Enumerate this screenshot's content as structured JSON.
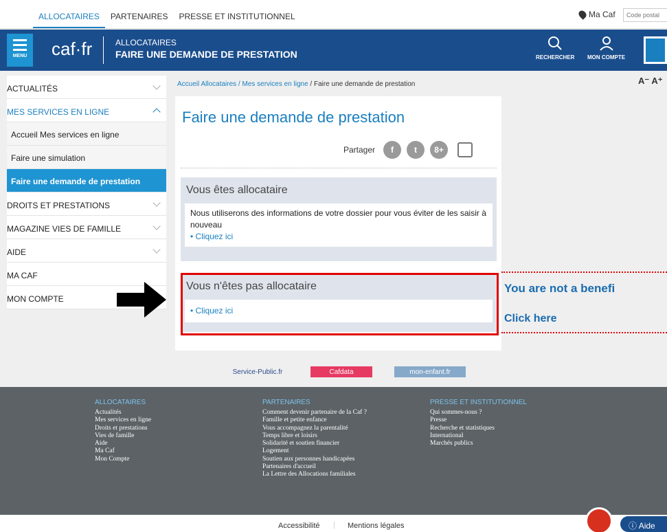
{
  "topbar": {
    "links": [
      "ALLOCATAIRES",
      "PARTENAIRES",
      "PRESSE ET INSTITUTIONNEL"
    ],
    "ma_caf": "Ma Caf",
    "postal_placeholder": "Code postal"
  },
  "header": {
    "menu_label": "MENU",
    "logo": "caf·fr",
    "section": "ALLOCATAIRES",
    "title": "FAIRE UNE DEMANDE DE PRESTATION",
    "search_label": "RECHERCHER",
    "account_label": "MON COMPTE"
  },
  "sidebar": {
    "items": [
      {
        "label": "ACTUALITÉS"
      },
      {
        "label": "MES SERVICES EN LIGNE"
      },
      {
        "label": "DROITS ET PRESTATIONS"
      },
      {
        "label": "MAGAZINE VIES DE FAMILLE"
      },
      {
        "label": "AIDE"
      },
      {
        "label": "MA CAF"
      },
      {
        "label": "MON COMPTE"
      }
    ],
    "sub": [
      "Accueil Mes services en ligne",
      "Faire une simulation",
      "Faire une demande de prestation"
    ]
  },
  "breadcrumb": {
    "part1": "Accueil Allocataires",
    "part2": "Mes services en ligne",
    "current": "Faire une demande de prestation"
  },
  "font_size": "A⁻ A⁺",
  "main": {
    "title": "Faire une demande de prestation",
    "share_label": "Partager",
    "share": {
      "facebook": "f",
      "twitter": "t",
      "google": "8+"
    },
    "panel1": {
      "heading": "Vous êtes allocataire",
      "text": "Nous utiliserons des informations de votre dossier pour vous éviter de les saisir à nouveau",
      "link": "• Cliquez ici"
    },
    "panel2": {
      "heading": "Vous n'êtes pas allocataire",
      "link": "• Cliquez ici"
    }
  },
  "annotation": {
    "line1": "You are not a benefi",
    "line2": "Click here",
    "color": "#e00000"
  },
  "partner_logos": [
    "Service-Public.fr",
    "Cafdata",
    "mon-enfant.fr"
  ],
  "footer": {
    "col1": {
      "heading": "ALLOCATAIRES",
      "items": [
        "Actualités",
        "Mes services en ligne",
        "Droits et prestations",
        "Vies de famille",
        "Aide",
        "Ma Caf",
        "Mon Compte"
      ]
    },
    "col2": {
      "heading": "PARTENAIRES",
      "items": [
        "Comment devenir partenaire de la Caf ?",
        "Famille et petite enfance",
        "Vous accompagnez la parentalité",
        "Temps libre et loisirs",
        "Solidarité et soutien financier",
        "Logement",
        "Soutien aux personnes handicapées",
        "Partenaires d'accueil",
        "La Lettre des Allocations familiales"
      ]
    },
    "col3": {
      "heading": "PRESSE ET INSTITUTIONNEL",
      "items": [
        "Qui sommes-nous ?",
        "Presse",
        "Recherche et statistiques",
        "International",
        "Marchés publics"
      ]
    }
  },
  "bottom": {
    "accessibility": "Accessibilité",
    "legal": "Mentions légales",
    "help": "Aide"
  }
}
